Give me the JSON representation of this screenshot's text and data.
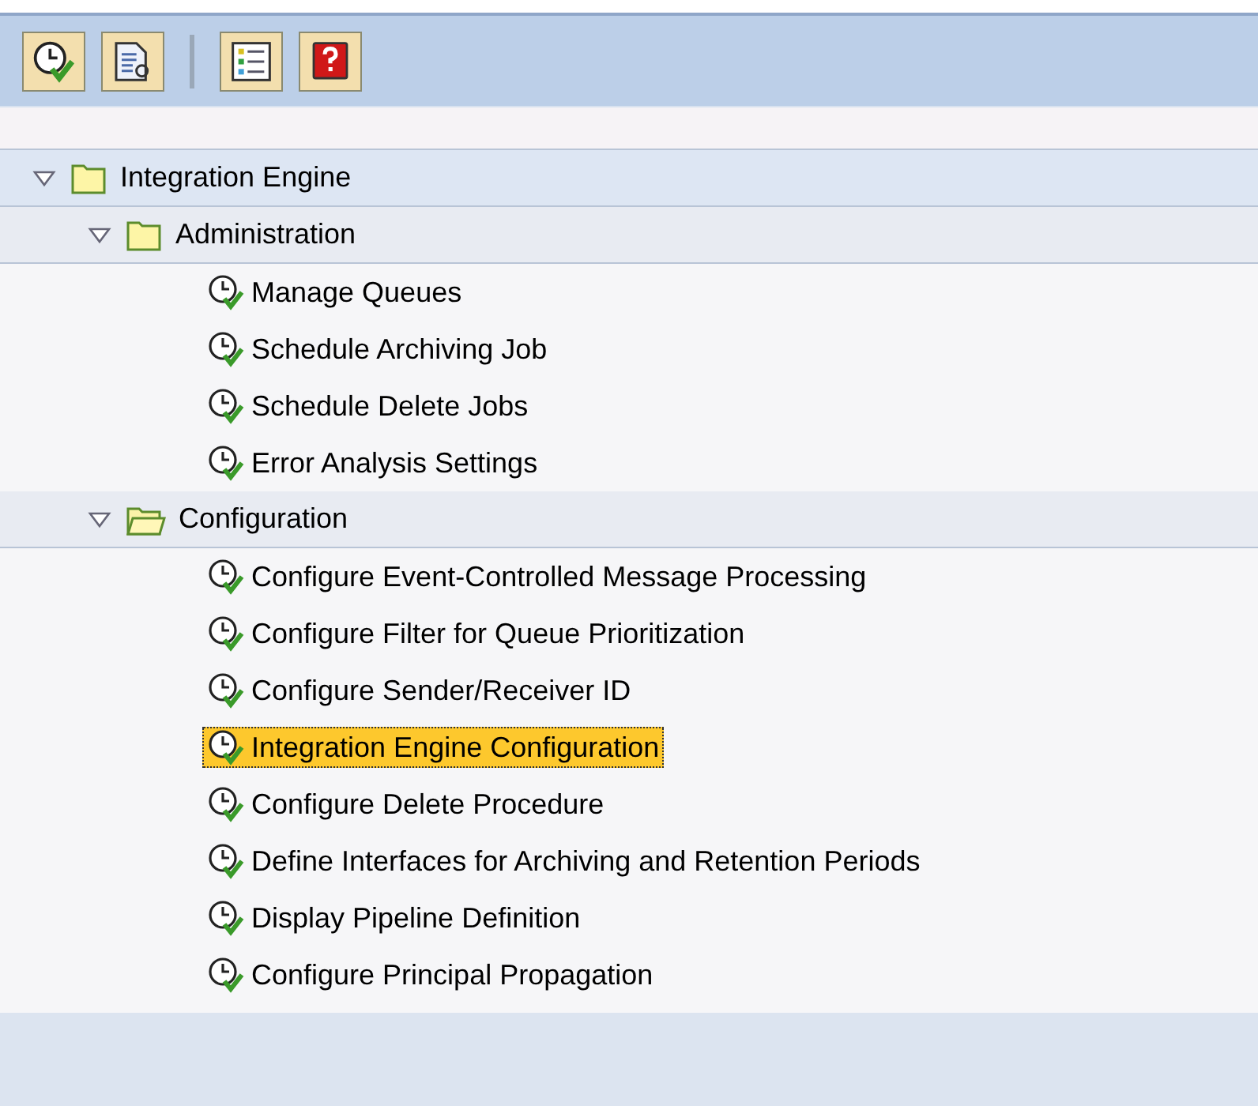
{
  "toolbar": {
    "buttons": [
      {
        "kind": "clock-check"
      },
      {
        "kind": "document"
      },
      {
        "kind": "separator"
      },
      {
        "kind": "list"
      },
      {
        "kind": "help"
      }
    ]
  },
  "tree": [
    {
      "label": "Integration Engine",
      "expanded": true,
      "open_folder": false,
      "children": [
        {
          "label": "Administration",
          "expanded": true,
          "open_folder": false,
          "children": [
            {
              "label": "Manage Queues",
              "selected": false
            },
            {
              "label": "Schedule Archiving Job",
              "selected": false
            },
            {
              "label": "Schedule Delete Jobs",
              "selected": false
            },
            {
              "label": "Error Analysis Settings",
              "selected": false
            }
          ]
        },
        {
          "label": "Configuration",
          "expanded": true,
          "open_folder": true,
          "children": [
            {
              "label": "Configure Event-Controlled Message Processing",
              "selected": false
            },
            {
              "label": "Configure Filter for Queue Prioritization",
              "selected": false
            },
            {
              "label": "Configure Sender/Receiver ID",
              "selected": false
            },
            {
              "label": "Integration Engine Configuration",
              "selected": true
            },
            {
              "label": "Configure Delete Procedure",
              "selected": false
            },
            {
              "label": "Define Interfaces for Archiving and Retention Periods",
              "selected": false
            },
            {
              "label": "Display Pipeline Definition",
              "selected": false
            },
            {
              "label": "Configure Principal Propagation",
              "selected": false
            }
          ]
        }
      ]
    }
  ]
}
